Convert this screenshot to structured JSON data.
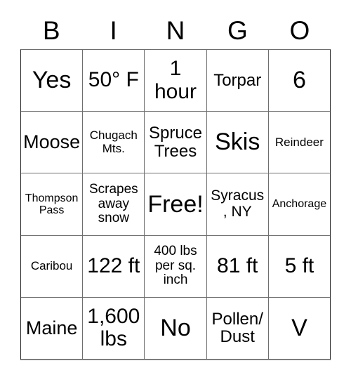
{
  "card": {
    "title": "BINGO",
    "columns": [
      "B",
      "I",
      "N",
      "G",
      "O"
    ],
    "free_space": "Free!",
    "rows": [
      [
        {
          "text": "Yes",
          "size": "fs-xxl"
        },
        {
          "text": "50° F",
          "size": "fs-xl"
        },
        {
          "text": "1 hour",
          "size": "fs-xl"
        },
        {
          "text": "Torpar",
          "size": "fs-md"
        },
        {
          "text": "6",
          "size": "fs-xxl"
        }
      ],
      [
        {
          "text": "Moose",
          "size": "fs-lg"
        },
        {
          "text": "Chugach Mts.",
          "size": "fs-xxs"
        },
        {
          "text": "Spruce Trees",
          "size": "fs-md"
        },
        {
          "text": "Skis",
          "size": "fs-xxl"
        },
        {
          "text": "Reindeer",
          "size": "fs-xxs"
        }
      ],
      [
        {
          "text": "Thompson Pass",
          "size": "fs-tiny"
        },
        {
          "text": "Scrapes away snow",
          "size": "fs-xs"
        },
        {
          "text": "Free!",
          "size": "fs-xxl"
        },
        {
          "text": "Syracus, NY",
          "size": "fs-sm"
        },
        {
          "text": "Anchorage",
          "size": "fs-tiny"
        }
      ],
      [
        {
          "text": "Caribou",
          "size": "fs-xxs"
        },
        {
          "text": "122 ft",
          "size": "fs-xl"
        },
        {
          "text": "400 lbs per sq. inch",
          "size": "fs-xs"
        },
        {
          "text": "81 ft",
          "size": "fs-xl"
        },
        {
          "text": "5 ft",
          "size": "fs-xl"
        }
      ],
      [
        {
          "text": "Maine",
          "size": "fs-lg"
        },
        {
          "text": "1,600 lbs",
          "size": "fs-xl"
        },
        {
          "text": "No",
          "size": "fs-xxl"
        },
        {
          "text": "Pollen/ Dust",
          "size": "fs-md"
        },
        {
          "text": "V",
          "size": "fs-xxl"
        }
      ]
    ]
  },
  "colors": {
    "background": "#ffffff",
    "text": "#000000",
    "grid_line": "#6e6e6e",
    "grid_outer": "#2a2a2a"
  }
}
